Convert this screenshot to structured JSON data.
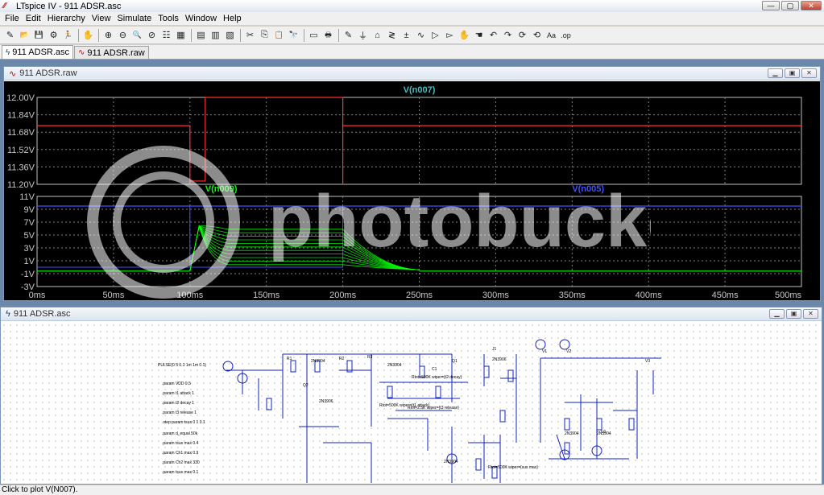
{
  "window": {
    "title": "LTspice IV - 911 ADSR.asc",
    "minimize": "—",
    "maximize": "▢",
    "close": "✕"
  },
  "menu": [
    "File",
    "Edit",
    "Hierarchy",
    "View",
    "Simulate",
    "Tools",
    "Window",
    "Help"
  ],
  "toolbar_icons": [
    "new-schematic-icon",
    "open-icon",
    "save-icon",
    "control-panel-icon",
    "run-icon",
    "halt-icon",
    "zoom-in-icon",
    "zoom-out-icon",
    "zoom-fit-icon",
    "zoom-cancel-icon",
    "autorange-icon",
    "grid-icon",
    "tile-horizontal-icon",
    "cascade-icon",
    "tile-vertical-icon",
    "cut-icon",
    "copy-icon",
    "paste-icon",
    "find-icon",
    "print-setup-icon",
    "print-icon",
    "wire-icon",
    "ground-icon",
    "label-icon",
    "resistor-icon",
    "capacitor-icon",
    "inductor-icon",
    "diode-icon",
    "component-icon",
    "move-icon",
    "drag-icon",
    "undo-icon",
    "redo-icon",
    "rotate-icon",
    "mirror-icon",
    "text-icon",
    "spice-directive-icon"
  ],
  "toolbar_glyphs": [
    "✎",
    "📂",
    "💾",
    "⚙",
    "🏃",
    "✋",
    "⊕",
    "⊖",
    "🔍",
    "⊘",
    "☷",
    "▦",
    "▤",
    "▥",
    "▧",
    "✂",
    "⎘",
    "📋",
    "🔭",
    "▭",
    "🖶",
    "✎",
    "⏚",
    "⌂",
    "≷",
    "±",
    "∿",
    "▷",
    "▻",
    "✋",
    "☚",
    "↶",
    "↷",
    "⟳",
    "⟲",
    "Aa",
    ".op"
  ],
  "tabs": [
    {
      "label": "911 ADSR.asc",
      "icon": "schematic-icon",
      "glyph": "ϟ"
    },
    {
      "label": "911 ADSR.raw",
      "icon": "waveform-icon",
      "glyph": "∿"
    }
  ],
  "plot_window": {
    "title": "911 ADSR.raw",
    "glyph": "∿",
    "top_pane": {
      "trace_label": "V(n007)",
      "trace_color": "#ff3030",
      "label_color": "#40c0c0",
      "y_ticks": [
        "12.00V",
        "11.84V",
        "11.68V",
        "11.52V",
        "11.36V",
        "11.20V"
      ]
    },
    "bottom_pane": {
      "trace_labels": [
        {
          "name": "V(n009)",
          "color": "#00ff00"
        },
        {
          "name": "V(n005)",
          "color": "#4050ff"
        }
      ],
      "y_ticks": [
        "11V",
        "9V",
        "7V",
        "5V",
        "3V",
        "1V",
        "-1V",
        "-3V"
      ]
    },
    "x_ticks": [
      "0ms",
      "50ms",
      "100ms",
      "150ms",
      "200ms",
      "250ms",
      "300ms",
      "350ms",
      "400ms",
      "450ms",
      "500ms"
    ]
  },
  "schematic_window": {
    "title": "911 ADSR.asc",
    "glyph": "ϟ",
    "texts": [
      "PULSE(0 5 0.1 1m 1m 0.1)",
      ".param VDD 9.5",
      ".param t1 attack 1",
      ".param t2 decay 1",
      ".param t3 release 1",
      ".step param tsus 0 1 0.1",
      ".param d_equal 50k",
      ".param tsus max 0.4",
      ".param Ch1 max 0.9",
      ".param Ch2 max 330",
      ".param tsus max 0.1",
      "Rtot=500K wiper={t1 attack}",
      "Rtot=500K wiper={t2 decay}",
      "Rtot=2.5K wiper={t3 release}",
      "Rtot=500K wiper={sus max}",
      "2N3904",
      "2N3906",
      "2N3904",
      "2N3906",
      "2N3904",
      "2N3904",
      "2N3904",
      "V1",
      "V2",
      "V3",
      "R1",
      "R2",
      "R3",
      "Q1",
      "Q2",
      "C1",
      "J1",
      "U1"
    ]
  },
  "watermark": {
    "brand": "photobucket"
  },
  "status_bar": {
    "text": "Click to plot V(N007)."
  }
}
